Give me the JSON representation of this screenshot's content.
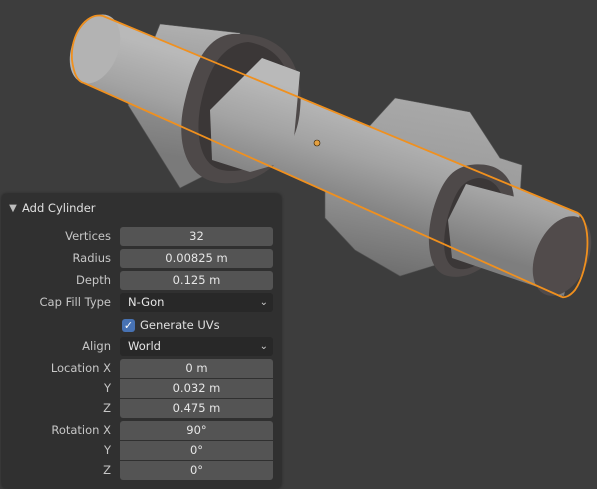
{
  "panel": {
    "title": "Add Cylinder",
    "vertices": {
      "label": "Vertices",
      "value": "32"
    },
    "radius": {
      "label": "Radius",
      "value": "0.00825 m"
    },
    "depth": {
      "label": "Depth",
      "value": "0.125 m"
    },
    "cap_fill_type": {
      "label": "Cap Fill Type",
      "value": "N-Gon"
    },
    "generate_uvs": {
      "label": "Generate UVs",
      "checked": true
    },
    "align": {
      "label": "Align",
      "value": "World"
    },
    "location": {
      "x_label": "Location X",
      "x": "0 m",
      "y_label": "Y",
      "y": "0.032 m",
      "z_label": "Z",
      "z": "0.475 m"
    },
    "rotation": {
      "x_label": "Rotation X",
      "x": "90°",
      "y_label": "Y",
      "y": "0°",
      "z_label": "Z",
      "z": "0°"
    }
  },
  "icons": {
    "collapse": "chevron-down-icon",
    "dropdown": "chevron-down-icon",
    "checkbox": "checkmark-icon"
  },
  "colors": {
    "viewport_bg": "#3d3d3d",
    "selection_outline": "#f0901e",
    "panel_bg": "#303030",
    "field_bg": "#545454",
    "checkbox_accent": "#4772b3"
  }
}
